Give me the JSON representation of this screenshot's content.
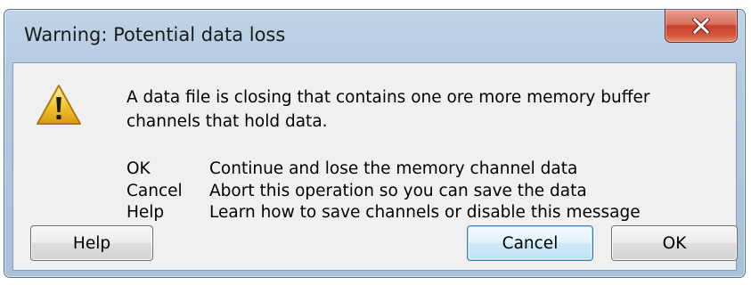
{
  "window": {
    "title": "Warning: Potential data loss",
    "close_label": "X"
  },
  "dialog": {
    "icon": "warning-icon",
    "message": "A data file is closing that contains one ore more memory buffer channels that hold data.",
    "options": [
      {
        "key": "OK",
        "description": "Continue and lose the memory channel data"
      },
      {
        "key": "Cancel",
        "description": "Abort this operation so you can save the data"
      },
      {
        "key": "Help",
        "description": "Learn how to save channels or disable this message"
      }
    ]
  },
  "buttons": {
    "help": "Help",
    "cancel": "Cancel",
    "ok": "OK"
  },
  "colors": {
    "title_bar": "#b3c9e0",
    "content_background": "#f0f0f0",
    "close_button": "#c7402b",
    "default_button_border": "#3c7fb1",
    "warning_icon_fill": "#f2c230"
  }
}
